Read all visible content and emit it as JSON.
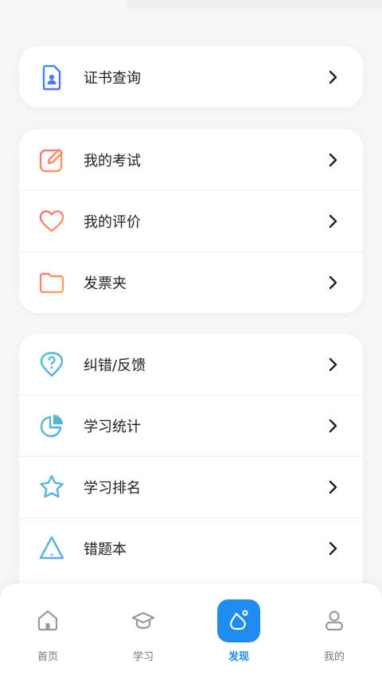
{
  "groups": [
    {
      "items": [
        {
          "label": "证书查询",
          "icon": "certificate-icon"
        }
      ]
    },
    {
      "items": [
        {
          "label": "我的考试",
          "icon": "edit-icon"
        },
        {
          "label": "我的评价",
          "icon": "heart-icon"
        },
        {
          "label": "发票夹",
          "icon": "folder-icon"
        }
      ]
    },
    {
      "items": [
        {
          "label": "纠错/反馈",
          "icon": "feedback-icon"
        },
        {
          "label": "学习统计",
          "icon": "pie-chart-icon"
        },
        {
          "label": "学习排名",
          "icon": "star-icon"
        },
        {
          "label": "错题本",
          "icon": "warning-icon"
        }
      ]
    }
  ],
  "tabbar": {
    "active": "发现",
    "tabs": [
      {
        "label": "首页",
        "icon": "home-icon"
      },
      {
        "label": "学习",
        "icon": "graduation-cap-icon"
      },
      {
        "label": "发现",
        "icon": "discover-icon"
      },
      {
        "label": "我的",
        "icon": "user-icon"
      }
    ]
  },
  "colors": {
    "accent": "#1f8cf0",
    "background": "#f6f6f6"
  }
}
